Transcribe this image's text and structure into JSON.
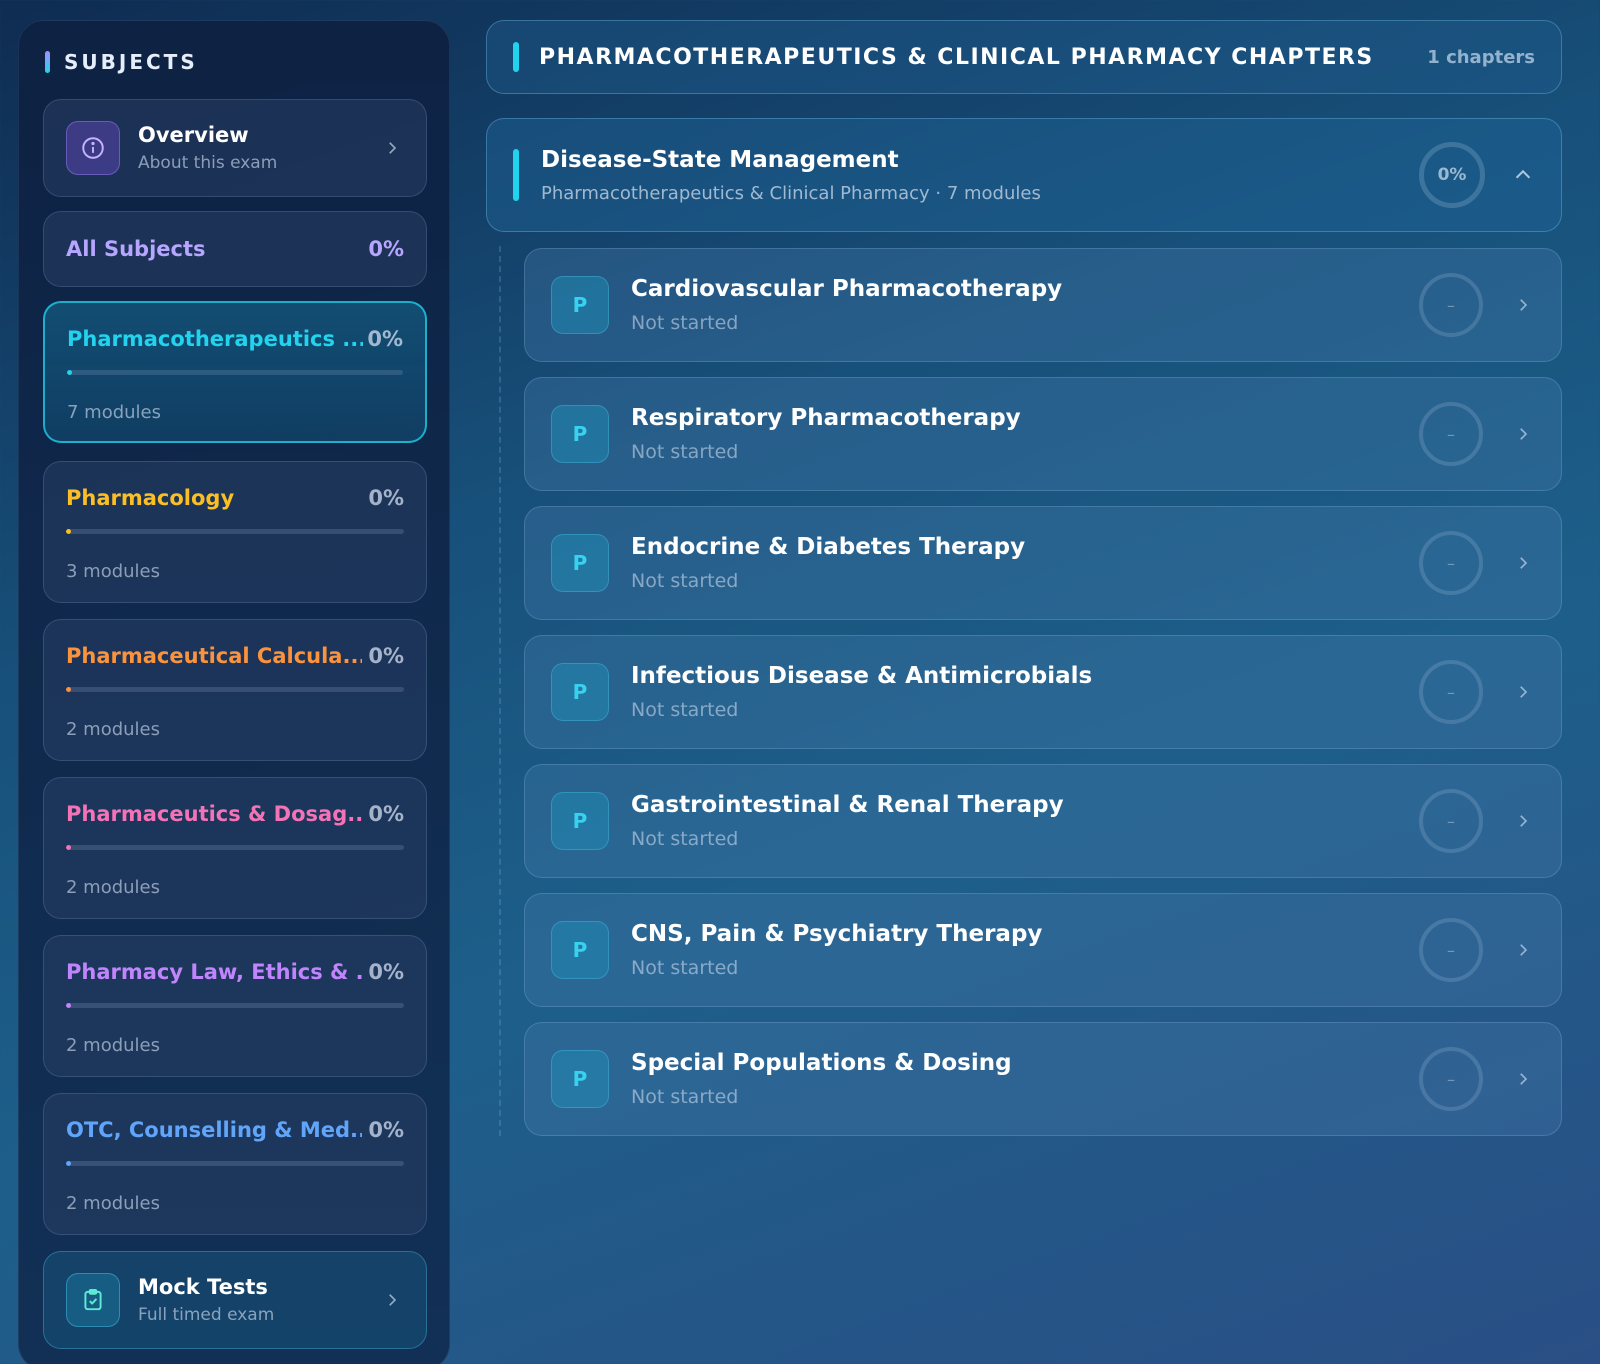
{
  "sidebar": {
    "heading": "SUBJECTS",
    "overview": {
      "title": "Overview",
      "subtitle": "About this exam",
      "icon": "info-icon",
      "accent": "#8b5cf6"
    },
    "all_subjects": {
      "label": "All Subjects",
      "percent": "0%"
    },
    "subjects": [
      {
        "name": "Pharmacotherapeutics ...",
        "percent": "0%",
        "progress": 0,
        "modules": "7 modules",
        "color": "#22d3ee",
        "active": true
      },
      {
        "name": "Pharmacology",
        "percent": "0%",
        "progress": 0,
        "modules": "3 modules",
        "color": "#fbbf24",
        "active": false
      },
      {
        "name": "Pharmaceutical Calcula...",
        "percent": "0%",
        "progress": 0,
        "modules": "2 modules",
        "color": "#fb923c",
        "active": false
      },
      {
        "name": "Pharmaceutics & Dosag...",
        "percent": "0%",
        "progress": 0,
        "modules": "2 modules",
        "color": "#f472b6",
        "active": false
      },
      {
        "name": "Pharmacy Law, Ethics & ...",
        "percent": "0%",
        "progress": 0,
        "modules": "2 modules",
        "color": "#c084fc",
        "active": false
      },
      {
        "name": "OTC, Counselling & Med...",
        "percent": "0%",
        "progress": 0,
        "modules": "2 modules",
        "color": "#60a5fa",
        "active": false
      }
    ],
    "mock_tests": {
      "title": "Mock Tests",
      "subtitle": "Full timed exam",
      "icon": "clipboard-check-icon",
      "accent": "#22d3ee"
    }
  },
  "main": {
    "header": {
      "title": "PHARMACOTHERAPEUTICS & CLINICAL PHARMACY CHAPTERS",
      "count": "1 chapters"
    },
    "chapter": {
      "title": "Disease-State Management",
      "subtitle": "Pharmacotherapeutics & Clinical Pharmacy · 7 modules",
      "percent": "0%",
      "expanded": true
    },
    "modules": [
      {
        "badge": "P",
        "title": "Cardiovascular Pharmacotherapy",
        "status": "Not started",
        "score": "–"
      },
      {
        "badge": "P",
        "title": "Respiratory Pharmacotherapy",
        "status": "Not started",
        "score": "–"
      },
      {
        "badge": "P",
        "title": "Endocrine & Diabetes Therapy",
        "status": "Not started",
        "score": "–"
      },
      {
        "badge": "P",
        "title": "Infectious Disease & Antimicrobials",
        "status": "Not started",
        "score": "–"
      },
      {
        "badge": "P",
        "title": "Gastrointestinal & Renal Therapy",
        "status": "Not started",
        "score": "–"
      },
      {
        "badge": "P",
        "title": "CNS, Pain & Psychiatry Therapy",
        "status": "Not started",
        "score": "–"
      },
      {
        "badge": "P",
        "title": "Special Populations & Dosing",
        "status": "Not started",
        "score": "–"
      }
    ]
  }
}
